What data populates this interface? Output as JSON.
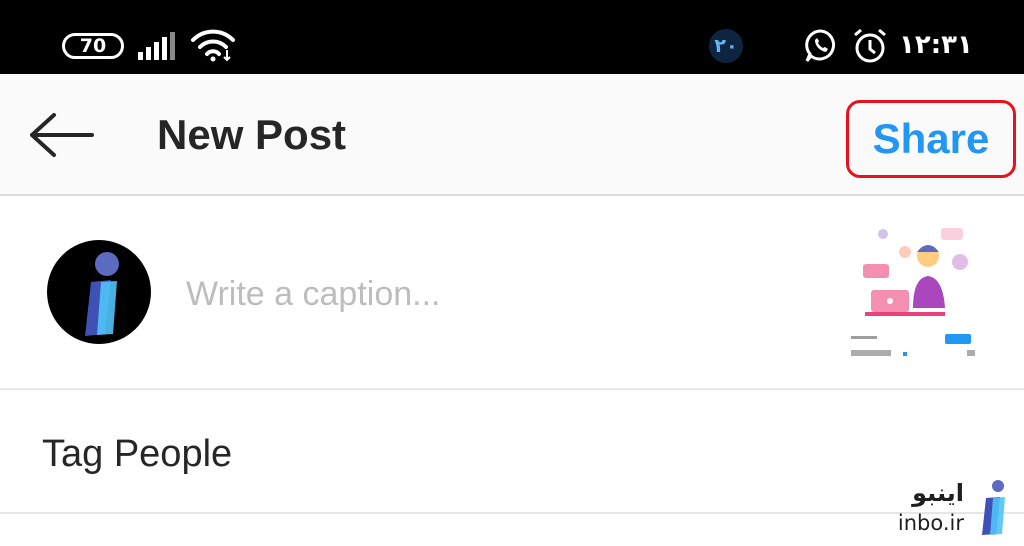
{
  "status_bar": {
    "battery": "70",
    "notification_count": "۲۰",
    "time": "۱۲:۳۱",
    "icons": [
      "signal-icon",
      "wifi-icon",
      "whatsapp-icon",
      "alarm-icon"
    ]
  },
  "header": {
    "title": "New Post",
    "share_label": "Share",
    "back_icon": "arrow-left-icon"
  },
  "caption": {
    "placeholder": "Write a caption..."
  },
  "tag_people": {
    "label": "Tag People"
  },
  "watermark": {
    "fa": "اینبو",
    "en": "inbo.ir"
  },
  "colors": {
    "accent": "#2196f3",
    "highlight_border": "#e8121e",
    "status_bar": "#000000",
    "header_bg": "#fafafa"
  }
}
